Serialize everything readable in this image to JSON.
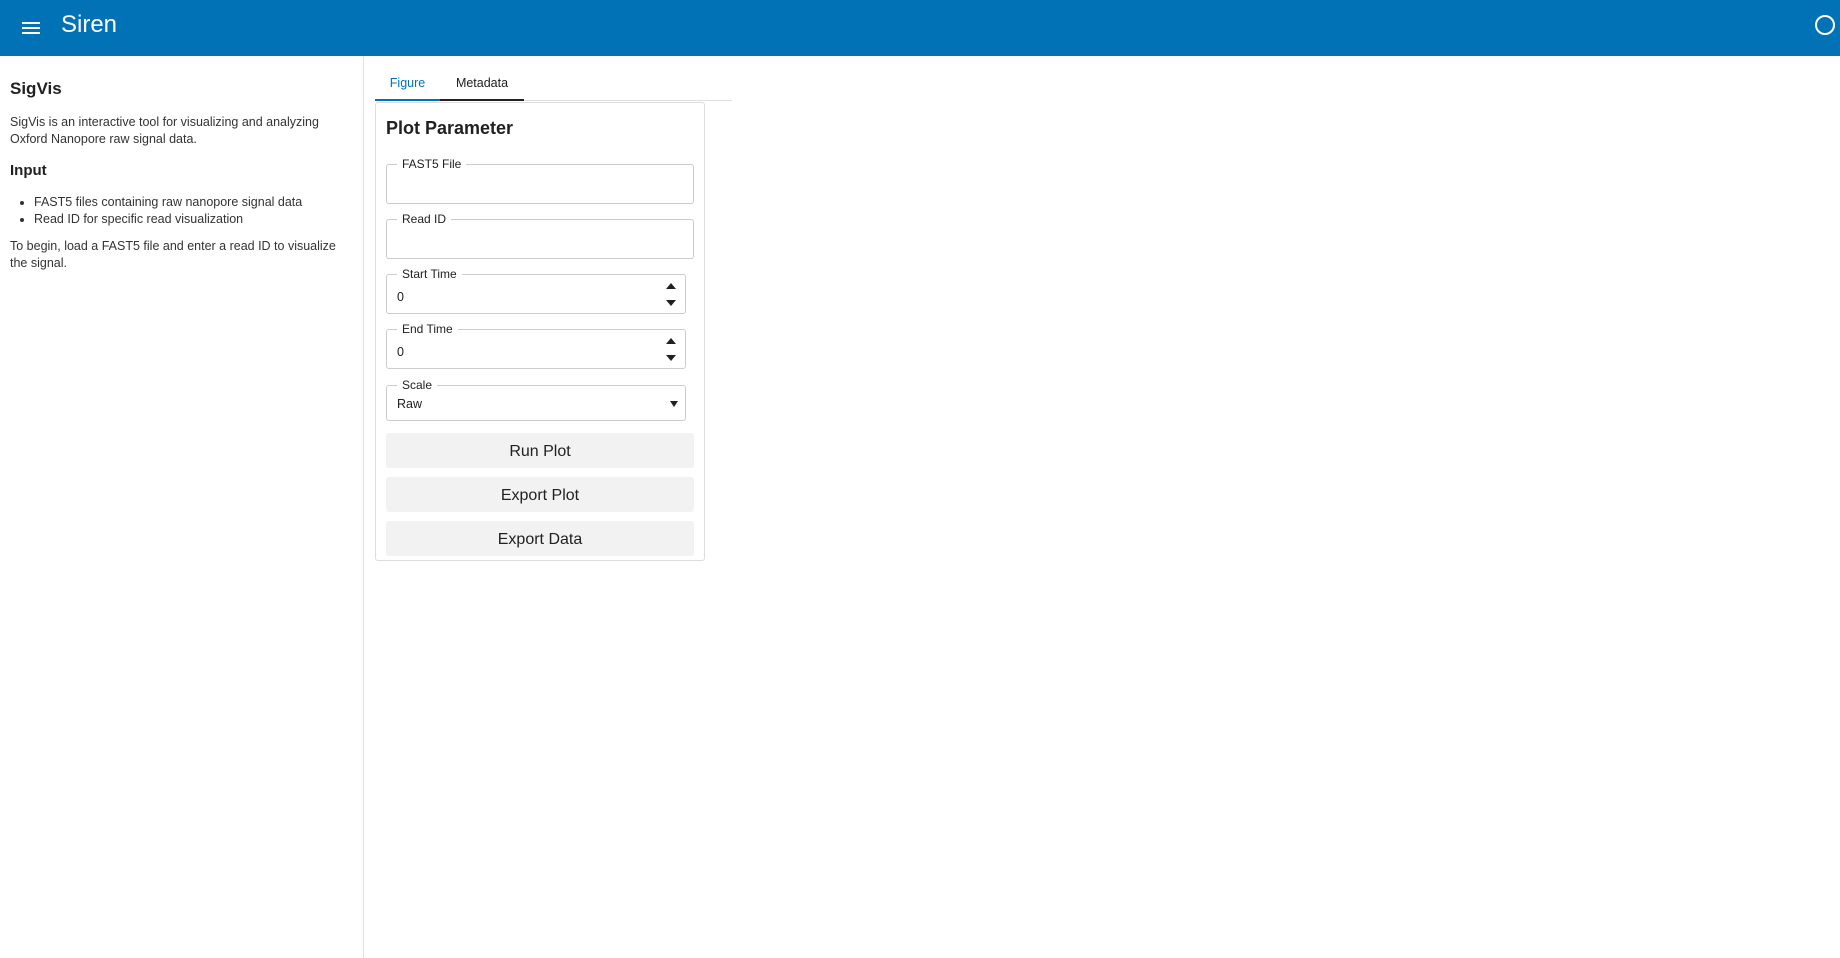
{
  "header": {
    "title": "Siren",
    "menu_icon": "hamburger-menu-icon",
    "status_icon": "circle-status-icon",
    "color": "#0072b5"
  },
  "sidebar": {
    "title": "SigVis",
    "description": "SigVis is an interactive tool for visualizing and analyzing Oxford Nanopore raw signal data.",
    "input_heading": "Input",
    "input_items": [
      "FAST5 files containing raw nanopore signal data",
      "Read ID for specific read visualization"
    ],
    "begin_text": "To begin, load a FAST5 file and enter a read ID to visualize the signal."
  },
  "tabs": [
    {
      "label": "Figure",
      "active": true
    },
    {
      "label": "Metadata",
      "active": false
    }
  ],
  "form": {
    "title": "Plot Parameter",
    "fast5_file": {
      "label": "FAST5 File",
      "value": ""
    },
    "read_id": {
      "label": "Read ID",
      "value": ""
    },
    "start_time": {
      "label": "Start Time",
      "value": "0"
    },
    "end_time": {
      "label": "End Time",
      "value": "0"
    },
    "scale": {
      "label": "Scale",
      "value": "Raw"
    },
    "buttons": {
      "run": "Run Plot",
      "export_plot": "Export Plot",
      "export_data": "Export Data"
    }
  },
  "colors": {
    "accent": "#0072b5",
    "button_bg": "#f2f2f2"
  }
}
